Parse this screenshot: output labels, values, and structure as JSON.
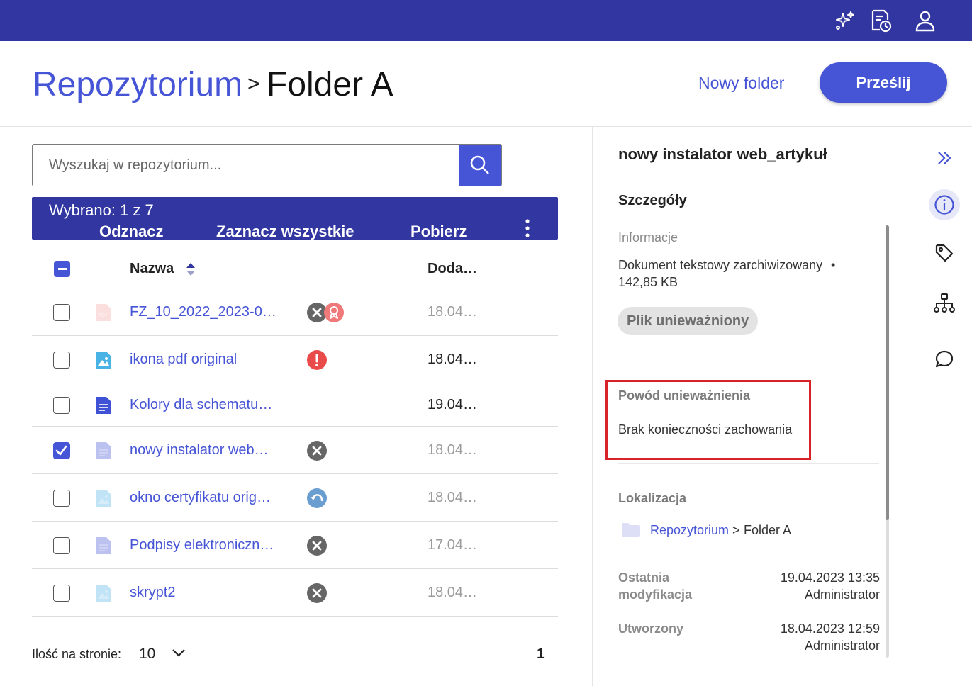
{
  "topbar": {
    "icons": [
      "sparkle-icon",
      "document-clock-icon",
      "user-icon"
    ],
    "background": "#3136a0"
  },
  "header": {
    "breadcrumb_root": "Repozytorium",
    "breadcrumb_separator": ">",
    "breadcrumb_current": "Folder A",
    "new_folder_label": "Nowy folder",
    "upload_label": "Prześlij"
  },
  "search": {
    "placeholder": "Wyszukaj w repozytorium..."
  },
  "selection_bar": {
    "count_label": "Wybrano: 1 z 7",
    "deselect_label": "Odznacz",
    "select_all_label": "Zaznacz wszystkie",
    "download_label": "Pobierz"
  },
  "table": {
    "columns": {
      "name": "Nazwa",
      "date": "Doda…"
    },
    "rows": [
      {
        "name": "FZ_10_2022_2023-0…",
        "date": "18.04…",
        "icon": "pdf-file-icon",
        "status": [
          "invalidated-icon",
          "certificate-icon"
        ],
        "checked": false,
        "dimmed": true
      },
      {
        "name": "ikona pdf original",
        "date": "18.04…",
        "icon": "image-file-icon",
        "status": [
          "error-icon"
        ],
        "checked": false,
        "dimmed": false
      },
      {
        "name": "Kolory dla schematu…",
        "date": "19.04…",
        "icon": "text-document-icon",
        "status": [],
        "checked": false,
        "dimmed": false
      },
      {
        "name": "nowy instalator web…",
        "date": "18.04…",
        "icon": "text-document-icon",
        "status": [
          "invalidated-icon"
        ],
        "checked": true,
        "dimmed": true
      },
      {
        "name": "okno certyfikatu orig…",
        "date": "18.04…",
        "icon": "image-file-icon",
        "status": [
          "restore-icon"
        ],
        "checked": false,
        "dimmed": true
      },
      {
        "name": "Podpisy elektroniczn…",
        "date": "17.04…",
        "icon": "text-document-icon",
        "status": [
          "invalidated-icon"
        ],
        "checked": false,
        "dimmed": true
      },
      {
        "name": "skrypt2",
        "date": "18.04…",
        "icon": "image-file-icon",
        "status": [
          "invalidated-icon"
        ],
        "checked": false,
        "dimmed": true
      }
    ]
  },
  "pagination": {
    "per_page_label": "Ilość na stronie:",
    "per_page_value": "10",
    "current_page": "1"
  },
  "details": {
    "title": "nowy instalator web_artykuł",
    "section": "Szczegóły",
    "info_label": "Informacje",
    "file_type": "Dokument tekstowy zarchiwizowany",
    "bullet": "•",
    "file_size": "142,85 KB",
    "status_chip": "Plik unieważniony",
    "invalidation_reason_label": "Powód unieważnienia",
    "invalidation_reason": "Brak konieczności zachowania",
    "location_label": "Lokalizacja",
    "location_root": "Repozytorium",
    "location_separator": ">",
    "location_current": "Folder A",
    "modified_label_line1": "Ostatnia",
    "modified_label_line2": "modyfikacja",
    "modified_date": "19.04.2023 13:35",
    "modified_by": "Administrator",
    "created_label": "Utworzony",
    "created_date": "18.04.2023 12:59",
    "created_by": "Administrator"
  },
  "rail": {
    "icons": [
      "collapse-icon",
      "info-icon",
      "tag-icon",
      "hierarchy-icon",
      "comment-icon"
    ]
  },
  "colors": {
    "primary": "#4654d6",
    "topbar": "#3136a0",
    "error": "#e94b4b",
    "invalidated": "#666666",
    "certificate": "#f07a7a",
    "restore": "#6a9ed0",
    "highlight_box": "#d8232a"
  }
}
